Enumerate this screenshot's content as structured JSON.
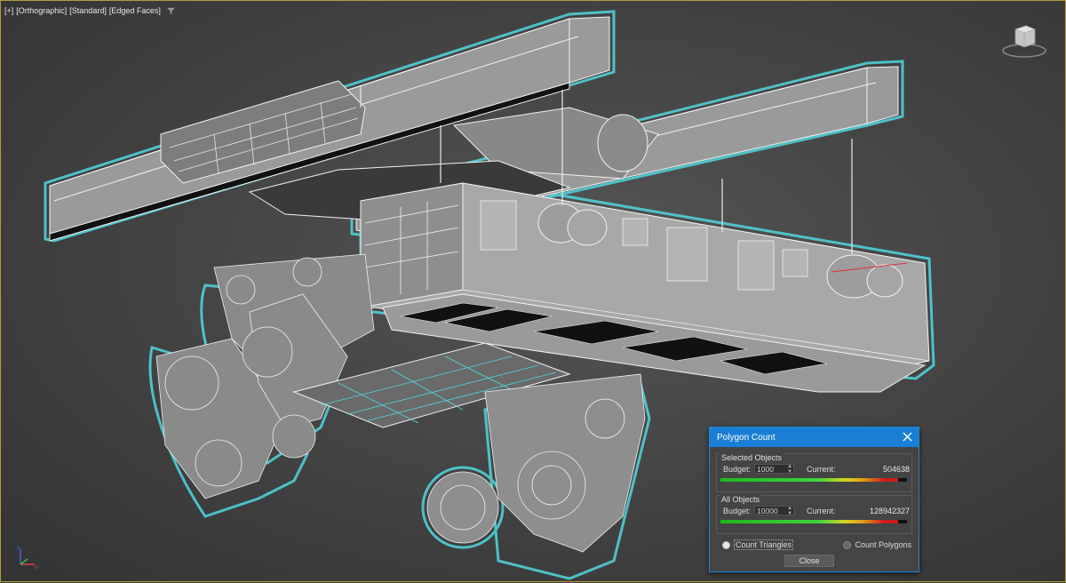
{
  "viewport": {
    "labels": [
      "[+]",
      "[Orthographic]",
      "[Standard]",
      "[Edged Faces]"
    ],
    "filter_icon": "funnel-icon",
    "accent": "#b89a3a"
  },
  "dialog": {
    "title": "Polygon Count",
    "accent": "#1a7fd4",
    "selected": {
      "title": "Selected Objects",
      "budget_label": "Budget:",
      "budget_value": "1000",
      "current_label": "Current:",
      "current_value": "504638",
      "meter_fill": 0.95
    },
    "all": {
      "title": "All Objects",
      "budget_label": "Budget:",
      "budget_value": "10000",
      "current_label": "Current:",
      "current_value": "128942327",
      "meter_fill": 0.95
    },
    "count_triangles": "Count Triangles",
    "count_polygons": "Count Polygons",
    "selected_mode": "triangles",
    "close_label": "Close"
  }
}
